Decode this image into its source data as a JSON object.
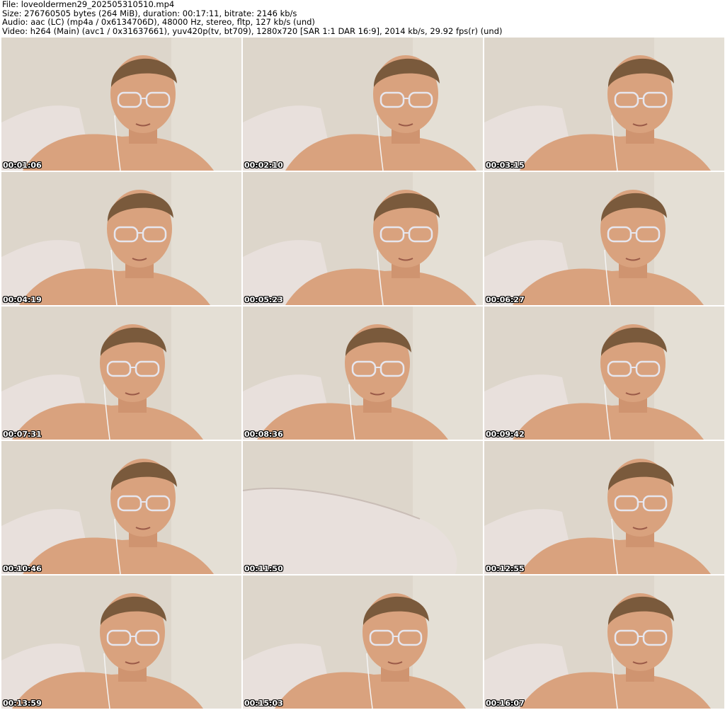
{
  "header": {
    "file_line": "File: loveoldermen29_202505310510.mp4",
    "size_line": "Size: 276760505 bytes (264 MiB), duration: 00:17:11, bitrate: 2146 kb/s",
    "audio_line": "Audio: aac (LC) (mp4a / 0x6134706D), 48000 Hz, stereo, fltp, 127 kb/s (und)",
    "video_line": "Video: h264 (Main) (avc1 / 0x31637661), yuv420p(tv, bt709), 1280x720 [SAR 1:1 DAR 16:9], 2014 kb/s, 29.92 fps(r) (und)"
  },
  "thumbnails": [
    {
      "timestamp": "00:01:06",
      "scene": "person"
    },
    {
      "timestamp": "00:02:10",
      "scene": "person"
    },
    {
      "timestamp": "00:03:15",
      "scene": "person"
    },
    {
      "timestamp": "00:04:19",
      "scene": "person"
    },
    {
      "timestamp": "00:05:23",
      "scene": "person"
    },
    {
      "timestamp": "00:06:27",
      "scene": "person"
    },
    {
      "timestamp": "00:07:31",
      "scene": "person"
    },
    {
      "timestamp": "00:08:36",
      "scene": "person"
    },
    {
      "timestamp": "00:09:42",
      "scene": "person"
    },
    {
      "timestamp": "00:10:46",
      "scene": "person"
    },
    {
      "timestamp": "00:11:50",
      "scene": "pillow"
    },
    {
      "timestamp": "00:12:55",
      "scene": "person"
    },
    {
      "timestamp": "00:13:59",
      "scene": "person"
    },
    {
      "timestamp": "00:15:03",
      "scene": "person"
    },
    {
      "timestamp": "00:16:07",
      "scene": "person"
    }
  ],
  "colors": {
    "wall": "#ddd6cb",
    "pillow": "#e8e0dc",
    "skin": "#d9a27e",
    "hair": "#7a5a3c",
    "timestamp_text": "#ffffff"
  }
}
